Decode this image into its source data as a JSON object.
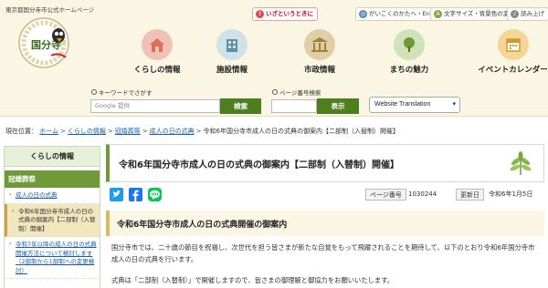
{
  "header": {
    "site_caption": "東京都国分寺市公式ホームページ",
    "logo_text": "国分寺",
    "utility": {
      "emergency": "いざというときに",
      "foreign": "がいこくのかたへ・English・中文",
      "text_color": "文字サイズ・背景色の変更",
      "read_aloud": "読み上げ"
    },
    "nav": [
      {
        "label": "くらしの情報"
      },
      {
        "label": "施設情報"
      },
      {
        "label": "市政情報"
      },
      {
        "label": "まちの魅力"
      },
      {
        "label": "イベントカレンダー"
      }
    ]
  },
  "search": {
    "keyword_caption": "キーワードでさがす",
    "keyword_placeholder": "Google 提供",
    "keyword_button": "検索",
    "page_caption": "ページ番号検索",
    "page_button": "表示",
    "translate_label": "Website Translation"
  },
  "breadcrumb": {
    "prefix": "現在位置：",
    "items": [
      "ホーム",
      "くらしの情報",
      "冠婚葬祭",
      "成人の日の式典"
    ],
    "current": "令和6年国分寺市成人の日の式典の御案内【二部制（入替制）開催】"
  },
  "sidebar": {
    "header": "くらしの情報",
    "category": "冠婚葬祭",
    "items": [
      {
        "label": "成人の日の式典"
      },
      {
        "label": "令和6年国分寺市成人の日の式典の御案内【二部制（入替制）開催】"
      },
      {
        "label": "令和7年以降の成人の日の式典開催方法について検討します（2部制から1部制への変更検討）"
      }
    ]
  },
  "main": {
    "title": "令和6年国分寺市成人の日の式典の御案内【二部制（入替制）開催】",
    "page_number_label": "ページ番号",
    "page_number": "1030244",
    "updated_label": "更新日",
    "updated_date": "令和6年1月5日",
    "section_title": "令和6年国分寺市成人の日の式典開催の御案内",
    "paragraph1": "国分寺市では、二十歳の節目を祝福し、次世代を担う皆さまが新たな自覚をもって飛躍されることを期待して、以下のとおり令和6年国分寺市成人の日の式典を行います。",
    "paragraph2": "式典は「二部制（入替制）」で開催しますので、皆さまの御理解と御協力をお願いいたします。"
  },
  "colors": {
    "header_bg": "#fbf6e4",
    "accent_green": "#6f9a3a",
    "button_green": "#4e7f1e",
    "emergency_red": "#c5001f",
    "link_blue": "#1a5ea8"
  }
}
